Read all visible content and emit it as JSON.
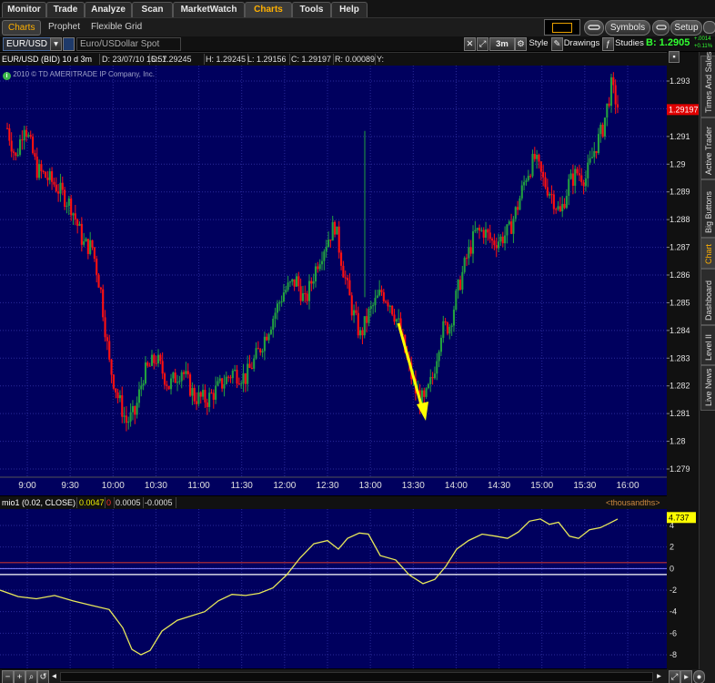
{
  "menu": {
    "tabs": [
      {
        "label": "Monitor"
      },
      {
        "label": "Trade"
      },
      {
        "label": "Analyze"
      },
      {
        "label": "Scan"
      },
      {
        "label": "MarketWatch"
      },
      {
        "label": "Charts",
        "active": true
      },
      {
        "label": "Tools"
      },
      {
        "label": "Help"
      }
    ]
  },
  "subtabs": [
    {
      "label": "Charts",
      "active": true
    },
    {
      "label": "Prophet"
    },
    {
      "label": "Flexible Grid"
    }
  ],
  "toolbar": {
    "symbols_label": "Symbols",
    "setup_label": "Setup"
  },
  "symbol_bar": {
    "symbol_value": "EUR/USD",
    "description": "Euro/USDollar Spot",
    "timeframe": "3m",
    "style_label": "Style",
    "drawings_label": "Drawings",
    "studies_label": "Studies",
    "bid_label": "B: 1.2905",
    "change_top": "+.0014",
    "change_bottom": "+0.11%"
  },
  "info_bar": {
    "title": "EUR/USD (BID) 10 d 3m",
    "date": "D: 23/07/10 15:57",
    "open": "O: 1.29245",
    "high": "H: 1.29245",
    "low": "L: 1.29156",
    "close": "C: 1.29197",
    "range": "R: 0.00089",
    "y": "Y:"
  },
  "copyright": "2010 © TD AMERITRADE IP Company, Inc.",
  "price_axis": {
    "ticks": [
      "1.293",
      "1.292",
      "1.291",
      "1.29",
      "1.289",
      "1.288",
      "1.287",
      "1.286",
      "1.285",
      "1.284",
      "1.283",
      "1.282",
      "1.281",
      "1.28",
      "1.279"
    ],
    "last_price": "1.29197",
    "last_price_color": "#e00000"
  },
  "time_axis": {
    "ticks": [
      "9:00",
      "9:30",
      "10:00",
      "10:30",
      "11:00",
      "11:30",
      "12:00",
      "12:30",
      "13:00",
      "13:30",
      "14:00",
      "14:30",
      "15:00",
      "15:30",
      "16:00"
    ]
  },
  "colors": {
    "chart_bg": "#00005e",
    "up_candle": "#22a040",
    "down_candle": "#ff1010",
    "arrow": "#ffff00",
    "indicator_line": "#e8e85a",
    "grid": "#2a2a9a"
  },
  "study": {
    "name": "mio1 (0.02, CLOSE)",
    "value1": "0.0047",
    "value2": "0",
    "value3": "0.0005",
    "value4": "-0.0005",
    "units": "<thousandths>",
    "last_value": "4.737",
    "axis_ticks": [
      "4",
      "2",
      "0",
      "-2",
      "-4",
      "-6",
      "-8"
    ]
  },
  "side_tabs": [
    {
      "label": "Times And Sales"
    },
    {
      "label": "Active Trader"
    },
    {
      "label": "Big Buttons"
    },
    {
      "label": "Chart",
      "active": true
    },
    {
      "label": "Dashboard"
    },
    {
      "label": "Level II"
    },
    {
      "label": "Live News"
    }
  ],
  "icons": {
    "symbols": "gear-icon",
    "setup": "wrench-icon",
    "info": "info-icon",
    "zoom": "magnifier-icon"
  }
}
